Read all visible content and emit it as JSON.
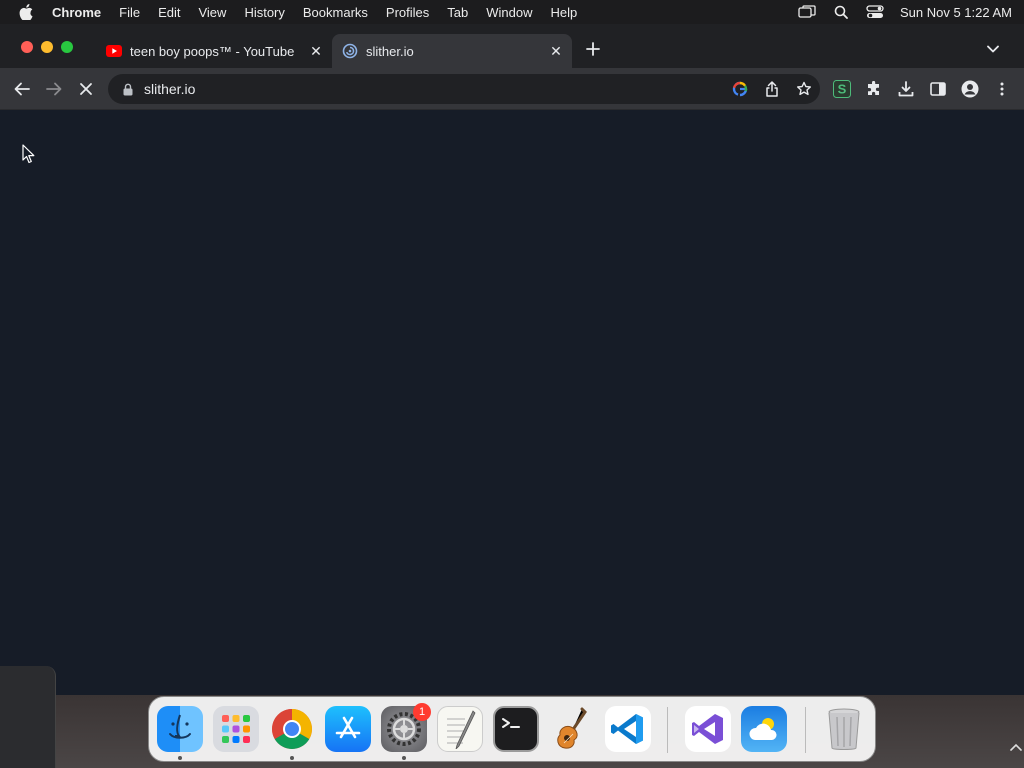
{
  "menubar": {
    "app_name": "Chrome",
    "items": [
      "File",
      "Edit",
      "View",
      "History",
      "Bookmarks",
      "Profiles",
      "Tab",
      "Window",
      "Help"
    ],
    "clock": "Sun Nov 5  1:22 AM"
  },
  "tabs": [
    {
      "title": "teen boy poops™ - YouTube",
      "favicon": "youtube-icon",
      "active": false
    },
    {
      "title": "slither.io",
      "favicon": "slither-icon",
      "active": true
    }
  ],
  "toolbar": {
    "url": "slither.io",
    "loading": true
  },
  "dock": {
    "apps": [
      "Finder",
      "Launchpad",
      "Google Chrome",
      "App Store",
      "System Settings",
      "TextEdit",
      "Terminal",
      "GarageBand",
      "Visual Studio Code",
      "Visual Studio",
      "Weather",
      "Trash"
    ],
    "settings_badge": "1"
  },
  "colors": {
    "page_background": "#161c27",
    "tab_active": "#35363a",
    "tabstrip": "#202124"
  }
}
